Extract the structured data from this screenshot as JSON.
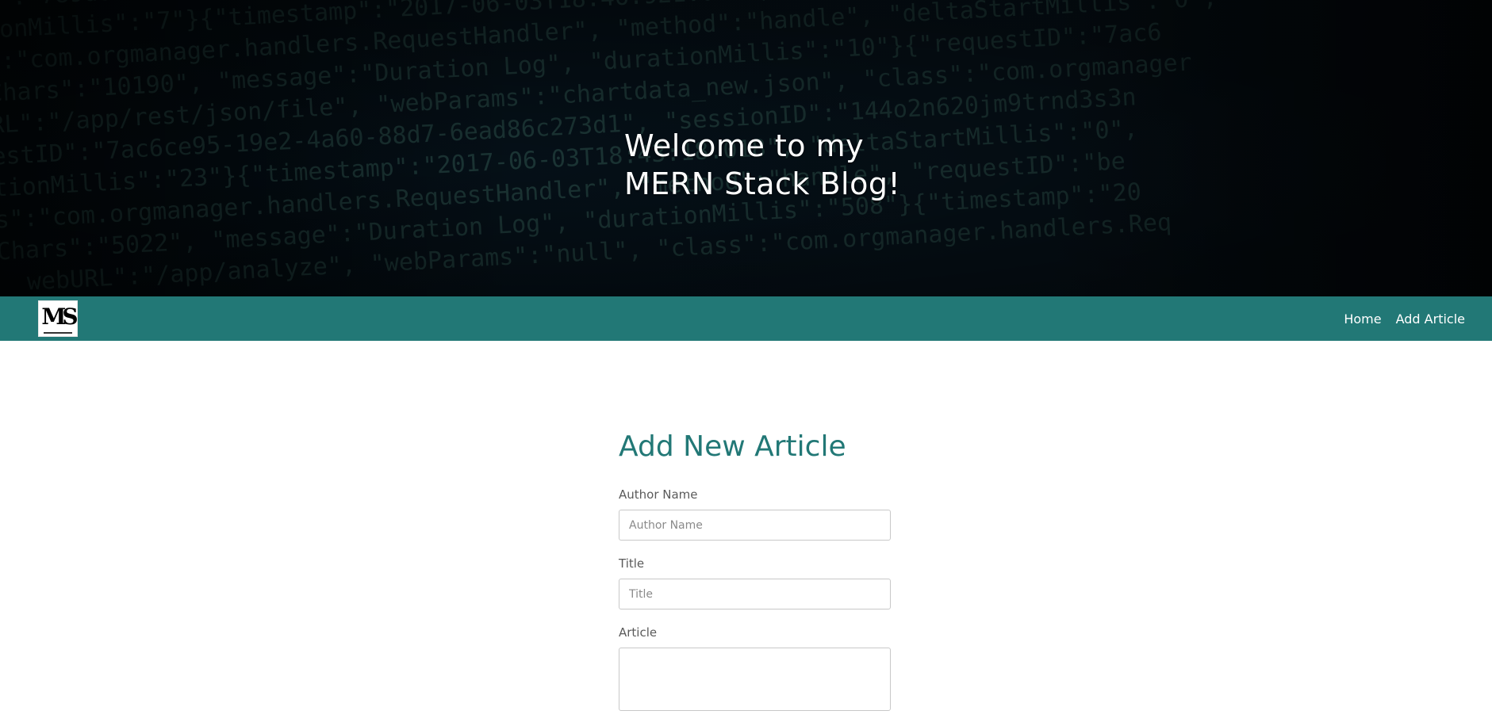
{
  "hero": {
    "title_line1": "Welcome to my",
    "title_line2": "MERN Stack Blog!"
  },
  "navbar": {
    "logo_icon": "ms-creative-logo",
    "links": [
      {
        "label": "Home"
      },
      {
        "label": "Add Article"
      }
    ],
    "background_color": "#227876"
  },
  "form": {
    "heading": "Add New Article",
    "fields": [
      {
        "label": "Author Name",
        "placeholder": "Author Name",
        "value": ""
      },
      {
        "label": "Title",
        "placeholder": "Title",
        "value": ""
      },
      {
        "label": "Article",
        "placeholder": "",
        "value": ""
      }
    ],
    "accent_color": "#227876"
  }
}
